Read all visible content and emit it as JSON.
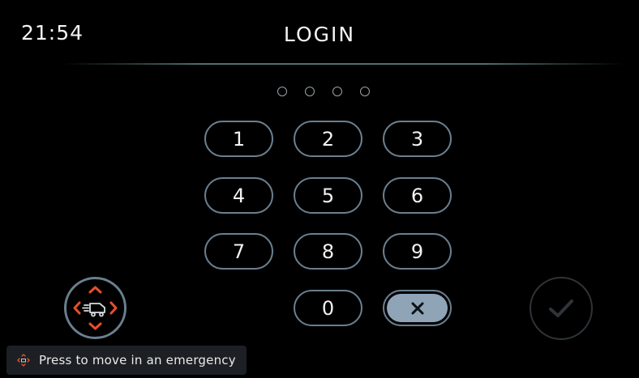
{
  "header": {
    "time": "21:54",
    "title": "LOGIN"
  },
  "pin": {
    "length": 4,
    "entered": 0
  },
  "keypad": {
    "keys": [
      "1",
      "2",
      "3",
      "4",
      "5",
      "6",
      "7",
      "8",
      "9",
      "0"
    ],
    "delete_icon": "close-x-icon"
  },
  "emergency": {
    "button_icon": "move-arrows-icon",
    "hint_icon": "move-arrows-icon",
    "hint_text": "Press to move in an emergency"
  },
  "confirm": {
    "icon": "checkmark-icon",
    "enabled": false
  },
  "colors": {
    "background": "#000000",
    "key_border": "#6a7f8f",
    "delete_fill": "#8fa4b7",
    "accent_orange": "#e8502a",
    "confirm_disabled": "#2f3438",
    "hint_background": "#1c2024"
  }
}
